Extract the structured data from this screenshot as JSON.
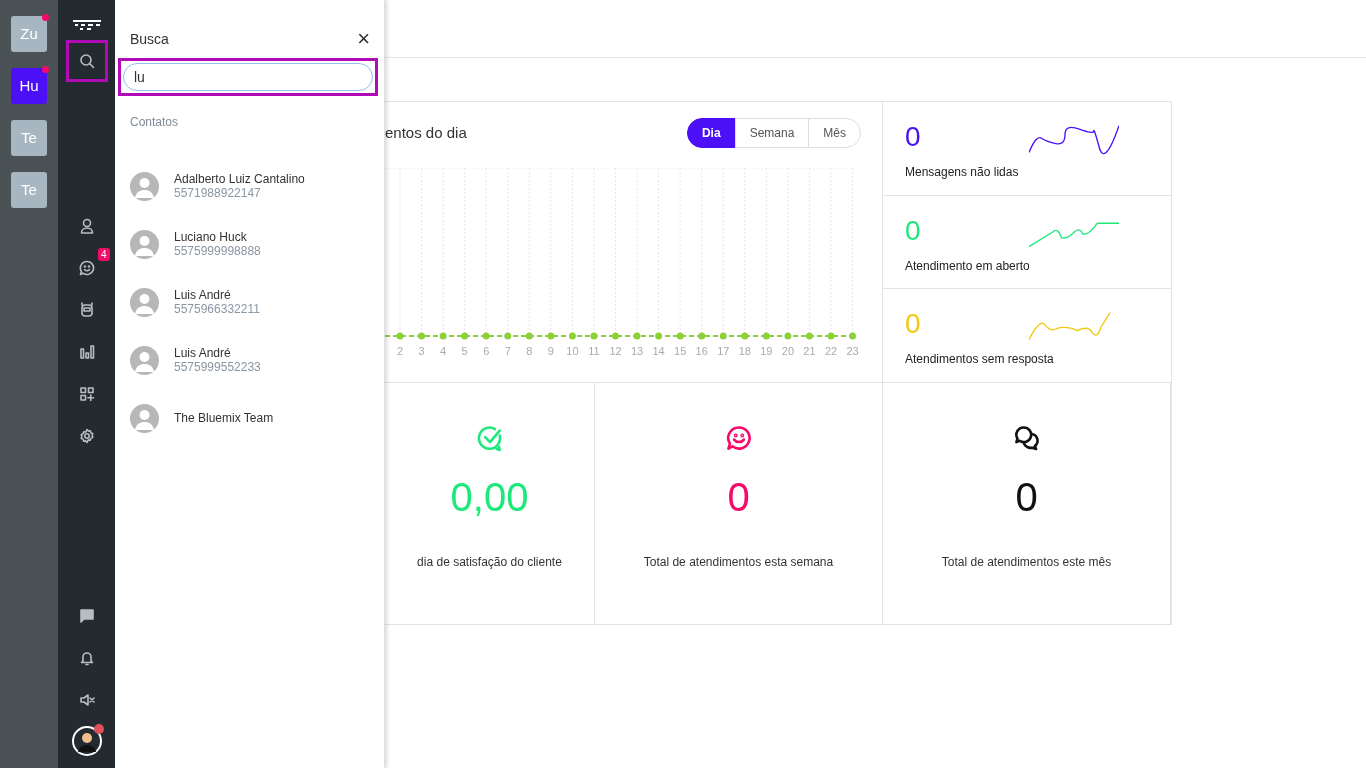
{
  "workspaces": [
    {
      "label": "Zu",
      "selected": false,
      "notification": true
    },
    {
      "label": "Hu",
      "selected": true,
      "notification": true
    },
    {
      "label": "Te",
      "selected": false,
      "notification": false
    },
    {
      "label": "Te",
      "selected": false,
      "notification": false
    }
  ],
  "nav": [
    {
      "selected": true
    },
    {
      "selected": false
    },
    {
      "selected": false,
      "badge": "4"
    },
    {
      "selected": false
    },
    {
      "selected": false
    },
    {
      "selected": false
    },
    {
      "selected": false
    }
  ],
  "nav_bottom": [
    {
      "selected": false
    },
    {
      "selected": false
    },
    {
      "selected": false
    }
  ],
  "profile": {
    "notification": true
  },
  "search_panel": {
    "title": "Busca",
    "close": "×",
    "field": {
      "value": "lu",
      "highlighted": true
    },
    "section": "Contatos",
    "contacts": [
      {
        "name": "Adalberto Luiz Cantalino",
        "phone": "5571988922147"
      },
      {
        "name": "Luciano Huck",
        "phone": "5575999998888"
      },
      {
        "name": "Luis André",
        "phone": "5575966332211"
      },
      {
        "name": "Luis André",
        "phone": "5575999552233"
      },
      {
        "name": "The Bluemix Team"
      }
    ]
  },
  "chart_card": {
    "title": "entos do dia",
    "periods": [
      {
        "label": "Dia",
        "selected": true
      },
      {
        "label": "Semana",
        "selected": false
      },
      {
        "label": "Mês",
        "selected": false
      }
    ],
    "x_labels": [
      "2",
      "3",
      "4",
      "5",
      "6",
      "7",
      "8",
      "9",
      "10",
      "11",
      "12",
      "13",
      "14",
      "15",
      "16",
      "17",
      "18",
      "19",
      "20",
      "21",
      "22",
      "23"
    ]
  },
  "stats": [
    {
      "value": "0",
      "label": "Mensagens não lidas",
      "color": "#4b10f5"
    },
    {
      "value": "0",
      "label": "Atendimento em aberto",
      "color": "#1de87c"
    },
    {
      "value": "0",
      "label": "Atendimentos sem resposta",
      "color": "#f2c913"
    }
  ],
  "totals": [
    {
      "value": "0,00",
      "label": "dia de satisfação do cliente",
      "color": "#1de87c"
    },
    {
      "value": "0",
      "label": "Total de atendimentos esta semana",
      "color": "#f50a6a"
    },
    {
      "value": "0",
      "label": "Total de atendimentos este mês",
      "color": "#111111"
    }
  ]
}
